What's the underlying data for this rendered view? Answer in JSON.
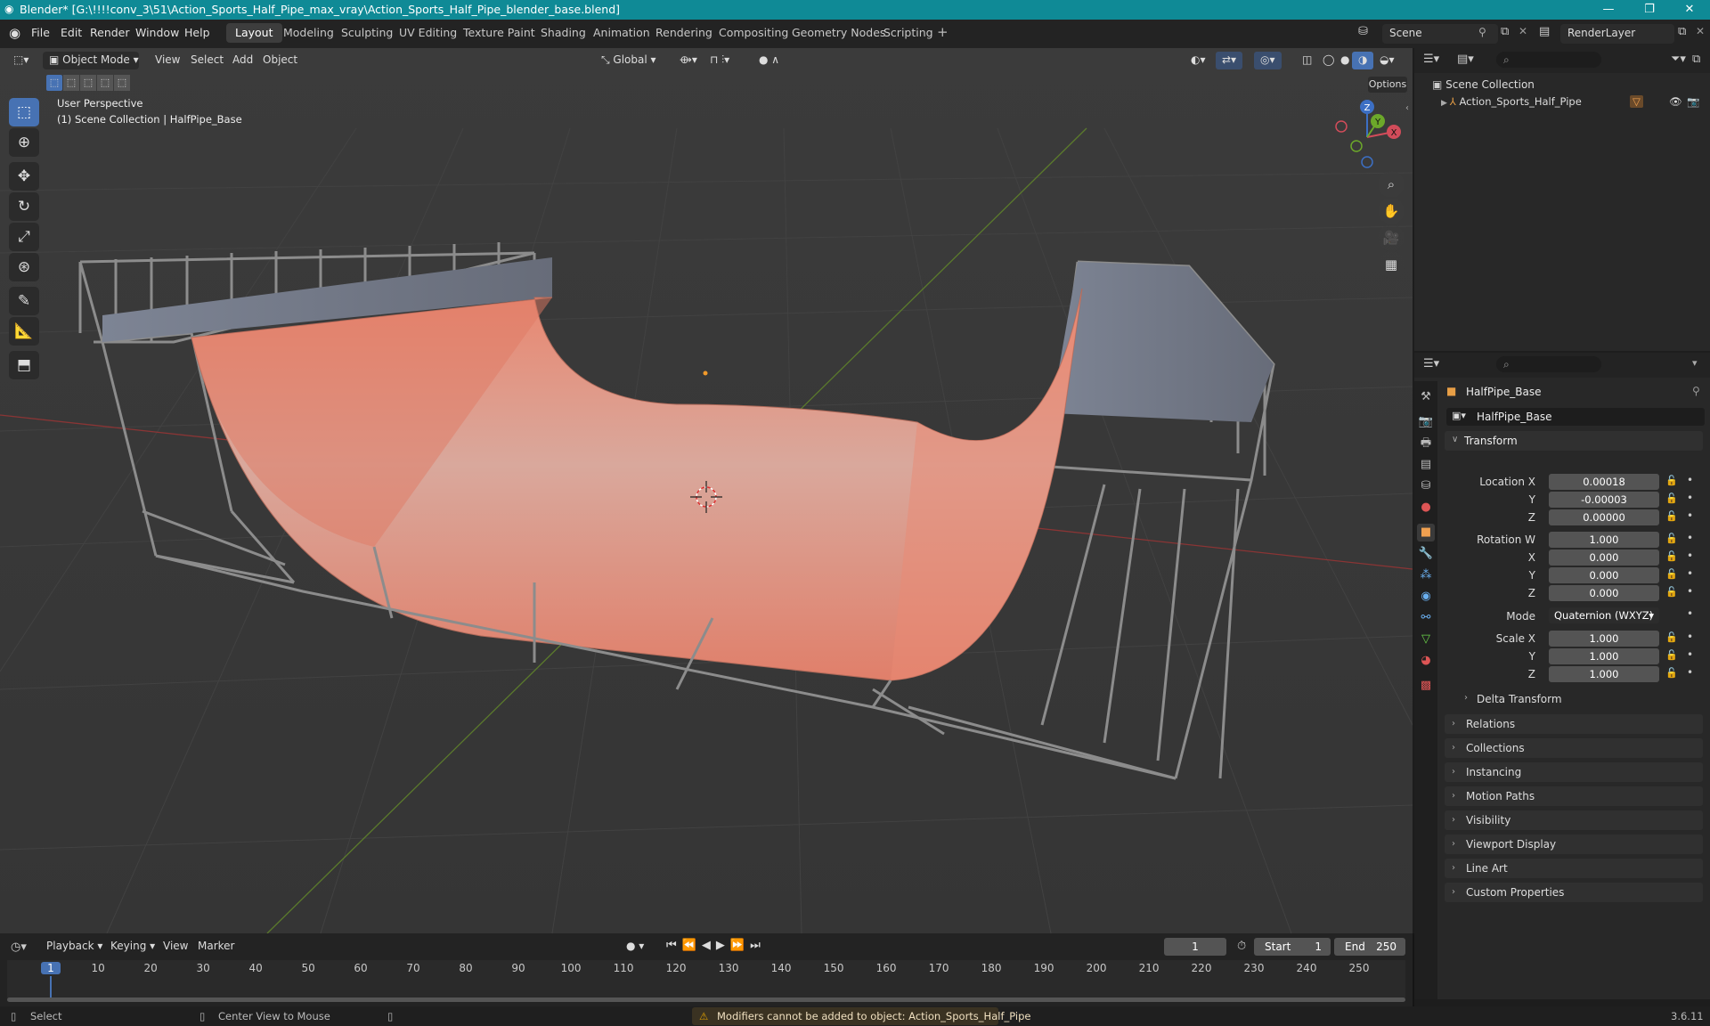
{
  "window": {
    "title": "Blender* [G:\\!!!!conv_3\\51\\Action_Sports_Half_Pipe_max_vray\\Action_Sports_Half_Pipe_blender_base.blend]",
    "minimize": "—",
    "maximize": "❐",
    "close": "✕"
  },
  "menus": [
    "File",
    "Edit",
    "Render",
    "Window",
    "Help"
  ],
  "workspaces": [
    "Layout",
    "Modeling",
    "Sculpting",
    "UV Editing",
    "Texture Paint",
    "Shading",
    "Animation",
    "Rendering",
    "Compositing",
    "Geometry Nodes",
    "Scripting"
  ],
  "scene": {
    "name": "Scene",
    "view_layer": "RenderLayer"
  },
  "viewport": {
    "mode": "Object Mode",
    "menus": [
      "View",
      "Select",
      "Add",
      "Object"
    ],
    "orientation": "Global",
    "options_label": "Options",
    "perspective_label": "User Perspective",
    "collection_label": "(1) Scene Collection | HalfPipe_Base",
    "axes": {
      "z": "Z",
      "y": "Y",
      "x": "X"
    }
  },
  "outliner": {
    "root": "Scene Collection",
    "items": [
      {
        "name": "Action_Sports_Half_Pipe"
      }
    ]
  },
  "properties": {
    "object_name": "HalfPipe_Base",
    "data_name": "HalfPipe_Base",
    "transform_label": "Transform",
    "location": {
      "label": "Location X",
      "x": "0.00018",
      "y": "-0.00003",
      "z": "0.00000"
    },
    "rotation": {
      "label": "Rotation W",
      "w": "1.000",
      "x": "0.000",
      "y": "0.000",
      "z": "0.000"
    },
    "mode": {
      "label": "Mode",
      "value": "Quaternion (WXYZ)"
    },
    "scale": {
      "label": "Scale X",
      "x": "1.000",
      "y": "1.000",
      "z": "1.000"
    },
    "axis_labels": {
      "y": "Y",
      "z": "Z",
      "x": "X"
    },
    "delta_transform": "Delta Transform",
    "panels": [
      "Relations",
      "Collections",
      "Instancing",
      "Motion Paths",
      "Visibility",
      "Viewport Display",
      "Line Art",
      "Custom Properties"
    ]
  },
  "timeline": {
    "menus": [
      "Playback",
      "Keying",
      "View",
      "Marker"
    ],
    "current_frame": "1",
    "start_label": "Start",
    "start": "1",
    "end_label": "End",
    "end": "250",
    "ruler": [
      "1",
      "10",
      "20",
      "30",
      "40",
      "50",
      "60",
      "70",
      "80",
      "90",
      "100",
      "110",
      "120",
      "130",
      "140",
      "150",
      "160",
      "170",
      "180",
      "190",
      "200",
      "210",
      "220",
      "230",
      "240",
      "250"
    ]
  },
  "status": {
    "select": "Select",
    "center_view": "Center View to Mouse",
    "warning": "Modifiers cannot be added to object: Action_Sports_Half_Pipe",
    "version": "3.6.11"
  },
  "colors": {
    "accent": "#4772b3",
    "title_bar": "#0f8a96",
    "ramp": "#e8826c",
    "frame": "#8a8a8a",
    "warning": "#e0a000"
  }
}
